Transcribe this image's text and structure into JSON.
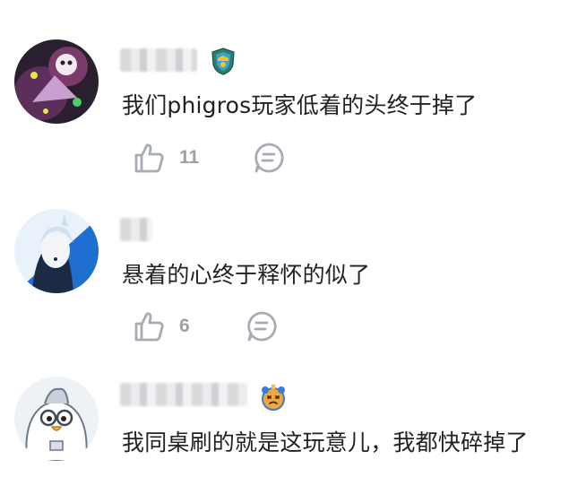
{
  "comments": [
    {
      "text": "我们phigros玩家低着的头终于掉了",
      "likes": "11",
      "badge": "shield-badge-icon",
      "avatar": "anime-character-avatar"
    },
    {
      "text": "悬着的心终于释怀的似了",
      "likes": "6",
      "avatar": "blue-hair-character-avatar"
    },
    {
      "text": "我同桌刷的就是这玩意儿，我都快碎掉了",
      "badge": "bear-face-badge-icon",
      "avatar": "bird-cartoon-avatar"
    }
  ],
  "colors": {
    "icon_gray": "#a7acb4",
    "count_gray": "#9aa0a8",
    "text": "#222222"
  }
}
